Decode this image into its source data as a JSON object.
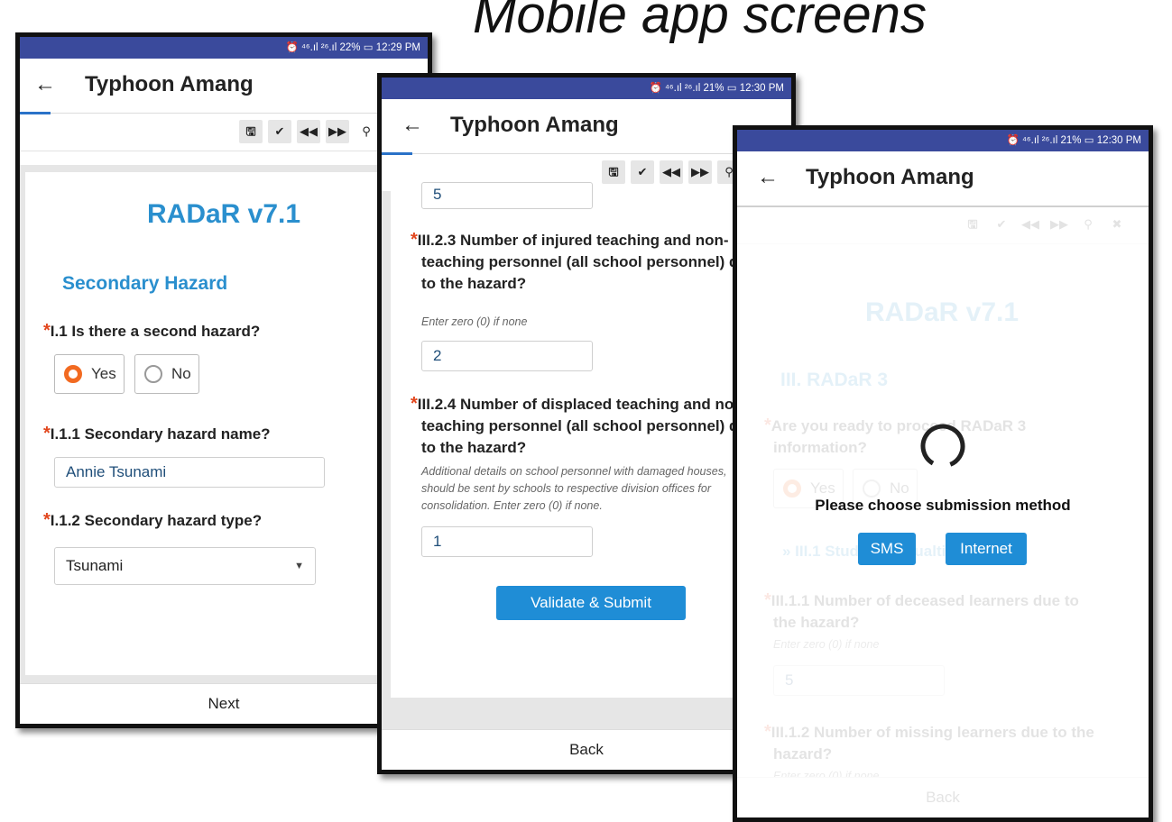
{
  "page": {
    "title": "Mobile app screens"
  },
  "screen1": {
    "status_time": "⏰ ⁴⁶.ıl ²⁶.ıl 22% ▭ 12:29 PM",
    "app_title": "Typhoon Amang",
    "form_title": "RADaR v7.1",
    "section": "Secondary Hazard",
    "q1": "I.1 Is there a second hazard?",
    "opt_yes": "Yes",
    "opt_no": "No",
    "q2": "I.1.1 Secondary hazard name?",
    "q2_value": "Annie Tsunami",
    "q3": "I.1.2 Secondary hazard type?",
    "q3_value": "Tsunami",
    "footer": "Next"
  },
  "screen2": {
    "status_time": "⏰ ⁴⁶.ıl ²⁶.ıl 21% ▭ 12:30 PM",
    "app_title": "Typhoon Amang",
    "prev_value": "5",
    "q1_line1": "III.2.3 Number of injured teaching and non-",
    "q1_line2": "teaching personnel (all school personnel) d",
    "q1_line3": "to the hazard?",
    "q1_hint": "Enter zero (0) if none",
    "q1_value": "2",
    "q2_line1": "III.2.4 Number of displaced teaching and no",
    "q2_line2": "teaching personnel (all school personnel) d",
    "q2_line3": "to the hazard?",
    "q2_hint1": "Additional details on school personnel with damaged houses,",
    "q2_hint2": "should be sent by schools to respective division offices for",
    "q2_hint3": "consolidation. Enter zero (0) if none.",
    "q2_value": "1",
    "submit": "Validate & Submit",
    "footer": "Back"
  },
  "screen3": {
    "status_time": "⏰ ⁴⁶.ıl ²⁶.ıl 21% ▭ 12:30 PM",
    "app_title": "Typhoon Amang",
    "bg_form_title": "RADaR v7.1",
    "bg_section": "III. RADaR 3",
    "bg_q1a": "Are you ready to proceed RADaR 3",
    "bg_q1b": "information?",
    "bg_yes": "Yes",
    "bg_no": "No",
    "bg_sub": "» III.1 Student Casualties",
    "bg_q2a": "III.1.1 Number of deceased learners due to",
    "bg_q2b": "the hazard?",
    "bg_hint": "Enter zero (0) if none",
    "bg_value": "5",
    "bg_q3a": "III.1.2 Number of missing learners due to the",
    "bg_q3b": "hazard?",
    "bg_hint2": "Enter zero (0) if none",
    "bg_footer": "Back",
    "dialog_text": "Please choose submission method",
    "btn_sms": "SMS",
    "btn_internet": "Internet"
  },
  "colors": {
    "statusbar": "#3a4a9c",
    "accent_blue": "#2a8fce",
    "button_blue": "#1f8dd6",
    "required": "#e2461d",
    "radio_selected": "#f26a21"
  },
  "icons": [
    "back-arrow-icon",
    "save-icon",
    "check-icon",
    "rewind-icon",
    "fast-forward-icon",
    "search-icon",
    "close-icon",
    "loading-spinner-icon"
  ]
}
